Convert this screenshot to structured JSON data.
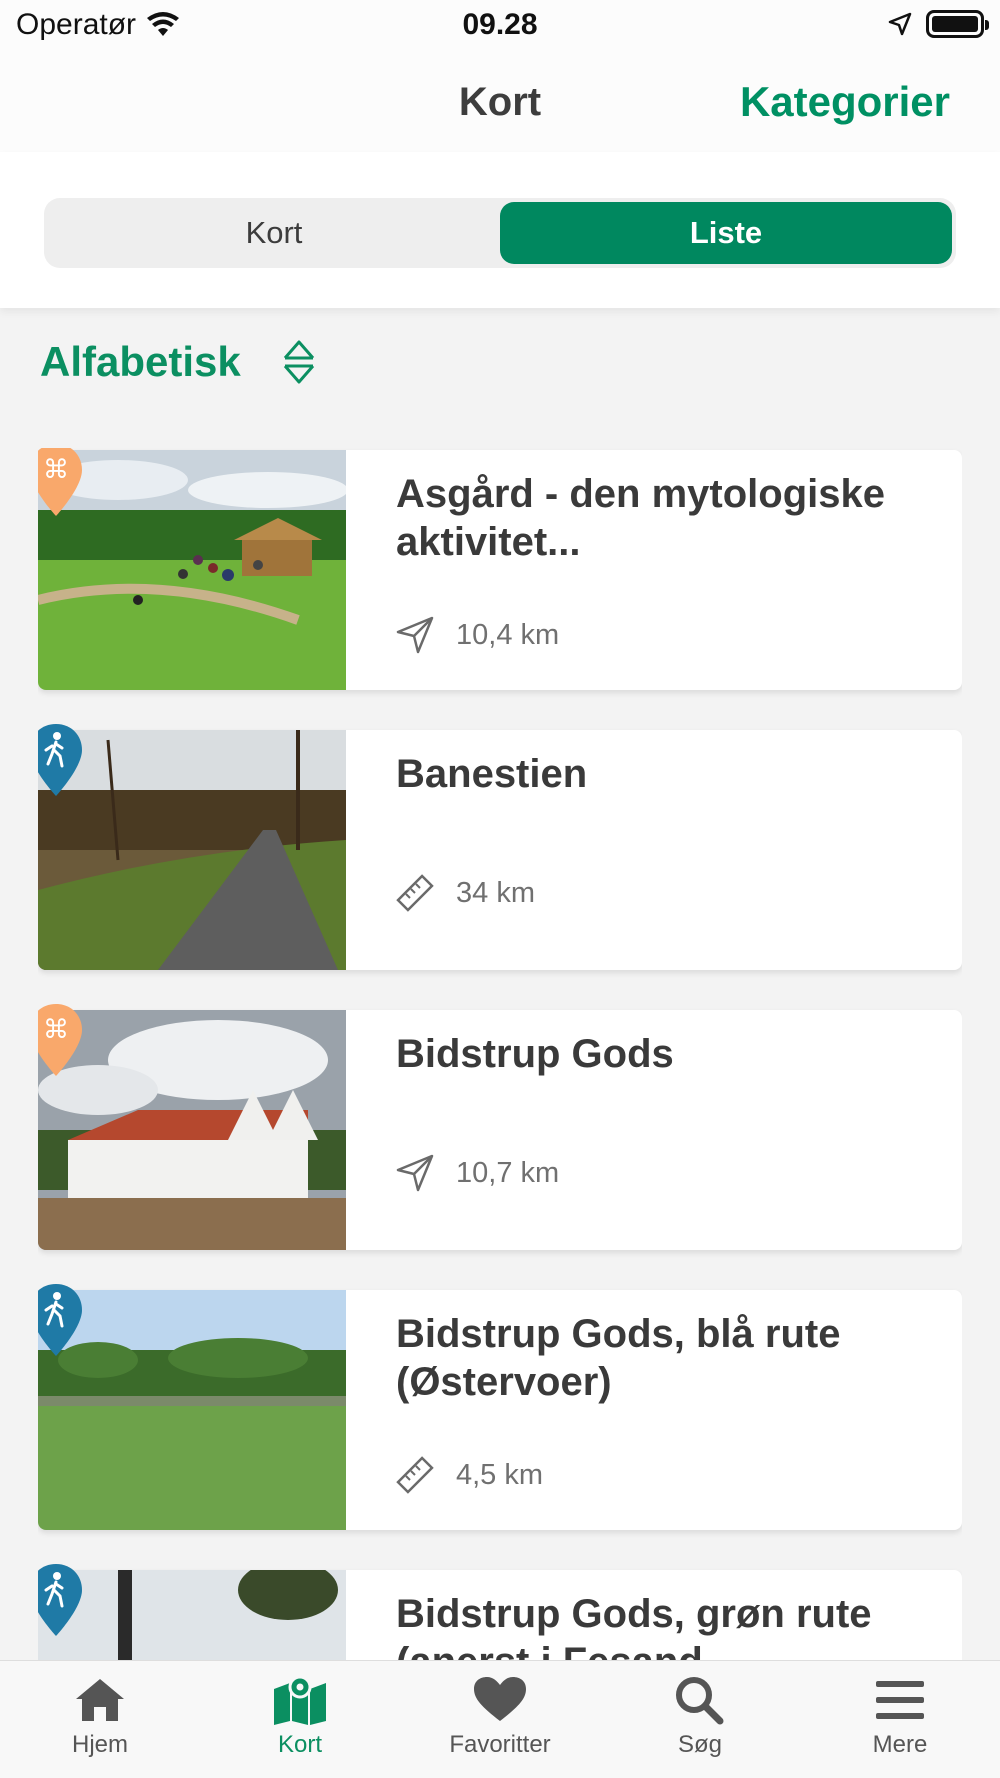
{
  "status_bar": {
    "carrier": "Operatør",
    "time": "09.28"
  },
  "nav": {
    "title": "Kort",
    "action": "Kategorier"
  },
  "segments": [
    {
      "label": "Kort",
      "active": false
    },
    {
      "label": "Liste",
      "active": true
    }
  ],
  "sort": {
    "label": "Alfabetisk",
    "icon": "sort-arrows-icon"
  },
  "list": [
    {
      "title": "Asgård - den mytologiske aktivitet...",
      "meta_icon": "navigation-arrow-icon",
      "meta_value": "10,4 km",
      "pin_color": "#f9a86b",
      "pin_icon": "command-icon"
    },
    {
      "title": "Banestien",
      "meta_icon": "ruler-icon",
      "meta_value": "34 km",
      "pin_color": "#1f7aa6",
      "pin_icon": "hiker-icon"
    },
    {
      "title": "Bidstrup Gods",
      "meta_icon": "navigation-arrow-icon",
      "meta_value": "10,7 km",
      "pin_color": "#f9a86b",
      "pin_icon": "command-icon"
    },
    {
      "title": "Bidstrup Gods, blå rute (Østervoer)",
      "meta_icon": "ruler-icon",
      "meta_value": "4,5 km",
      "pin_color": "#1f7aa6",
      "pin_icon": "hiker-icon"
    },
    {
      "title": "Bidstrup Gods, grøn rute (anerst i Fesand",
      "meta_icon": "ruler-icon",
      "meta_value": "",
      "pin_color": "#1f7aa6",
      "pin_icon": "hiker-icon"
    }
  ],
  "tabs": [
    {
      "label": "Hjem",
      "icon": "home-icon",
      "active": false
    },
    {
      "label": "Kort",
      "icon": "map-icon",
      "active": true
    },
    {
      "label": "Favoritter",
      "icon": "heart-icon",
      "active": false
    },
    {
      "label": "Søg",
      "icon": "search-icon",
      "active": false
    },
    {
      "label": "Mere",
      "icon": "menu-icon",
      "active": false
    }
  ],
  "colors": {
    "accent": "#009063",
    "segment_active": "#00885f",
    "orange_pin": "#f9a86b",
    "blue_pin": "#1f7aa6"
  }
}
